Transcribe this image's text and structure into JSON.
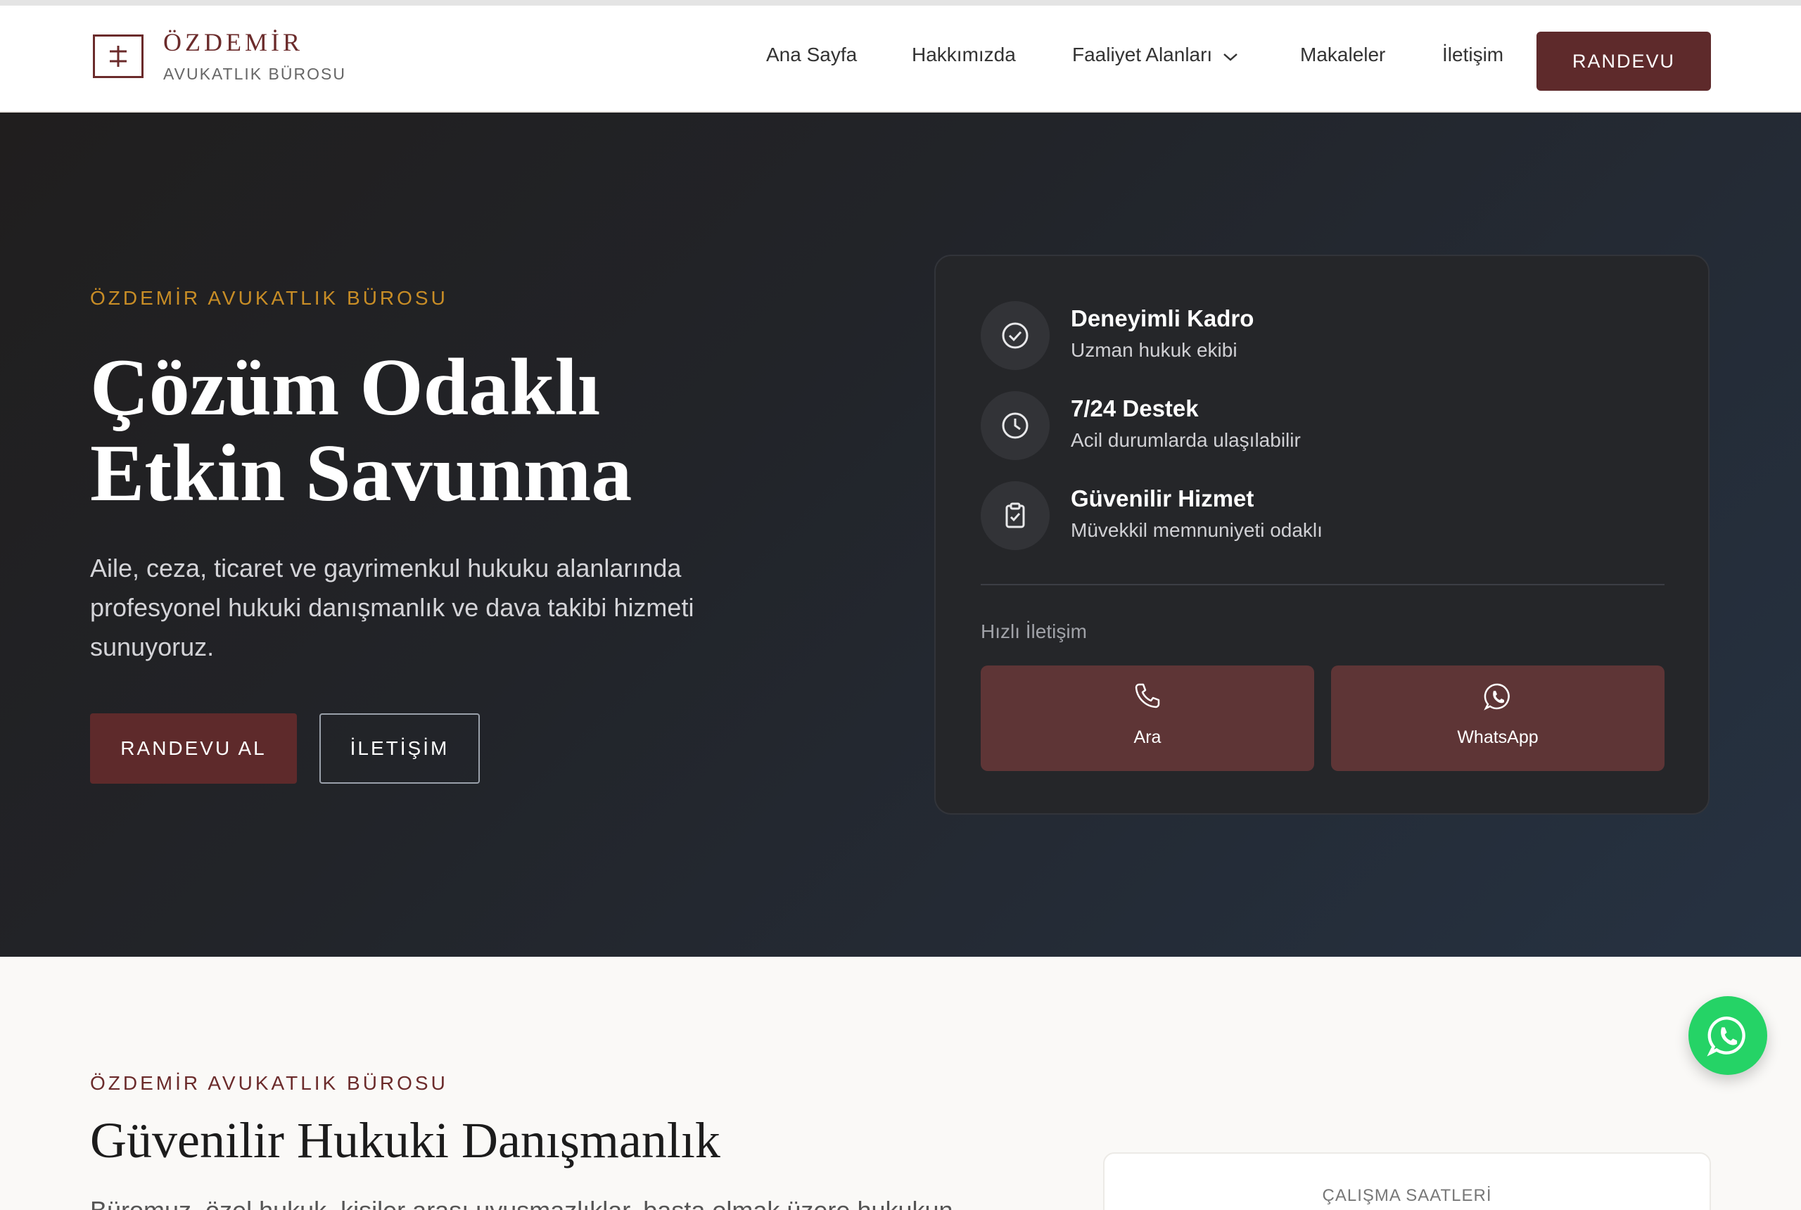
{
  "brand": {
    "name": "ÖZDEMİR",
    "subtitle": "AVUKATLIK BÜROSU"
  },
  "nav": {
    "items": [
      {
        "label": "Ana Sayfa"
      },
      {
        "label": "Hakkımızda"
      },
      {
        "label": "Faaliyet Alanları"
      },
      {
        "label": "Makaleler"
      },
      {
        "label": "İletişim"
      }
    ],
    "cta": "RANDEVU"
  },
  "hero": {
    "kicker": "ÖZDEMİR AVUKATLIK BÜROSU",
    "title_line1": "Çözüm Odaklı",
    "title_line2": "Etkin Savunma",
    "description": "Aile, ceza, ticaret ve gayrimenkul hukuku alanlarında profesyonel hukuki danışmanlık ve dava takibi hizmeti sunuyoruz.",
    "primary_button": "RANDEVU AL",
    "secondary_button": "İLETİŞİM"
  },
  "features": [
    {
      "title": "Deneyimli Kadro",
      "subtitle": "Uzman hukuk ekibi",
      "icon": "check-circle-icon"
    },
    {
      "title": "7/24 Destek",
      "subtitle": "Acil durumlarda ulaşılabilir",
      "icon": "clock-icon"
    },
    {
      "title": "Güvenilir Hizmet",
      "subtitle": "Müvekkil memnuniyeti odaklı",
      "icon": "clipboard-check-icon"
    }
  ],
  "quick_contact": {
    "label": "Hızlı İletişim",
    "call": "Ara",
    "whatsapp": "WhatsApp"
  },
  "section2": {
    "kicker": "ÖZDEMİR AVUKATLIK BÜROSU",
    "title": "Güvenilir Hukuki Danışmanlık",
    "body": "Büromuz, özel hukuk, kişiler arası uyuşmazlıklar, başta olmak üzere hukukun",
    "hours_label": "ÇALIŞMA SAATLERİ"
  },
  "colors": {
    "brand": "#6b2b2b",
    "button": "#5e2a2b",
    "accent_gold": "#c88d26",
    "whatsapp": "#25d366"
  }
}
